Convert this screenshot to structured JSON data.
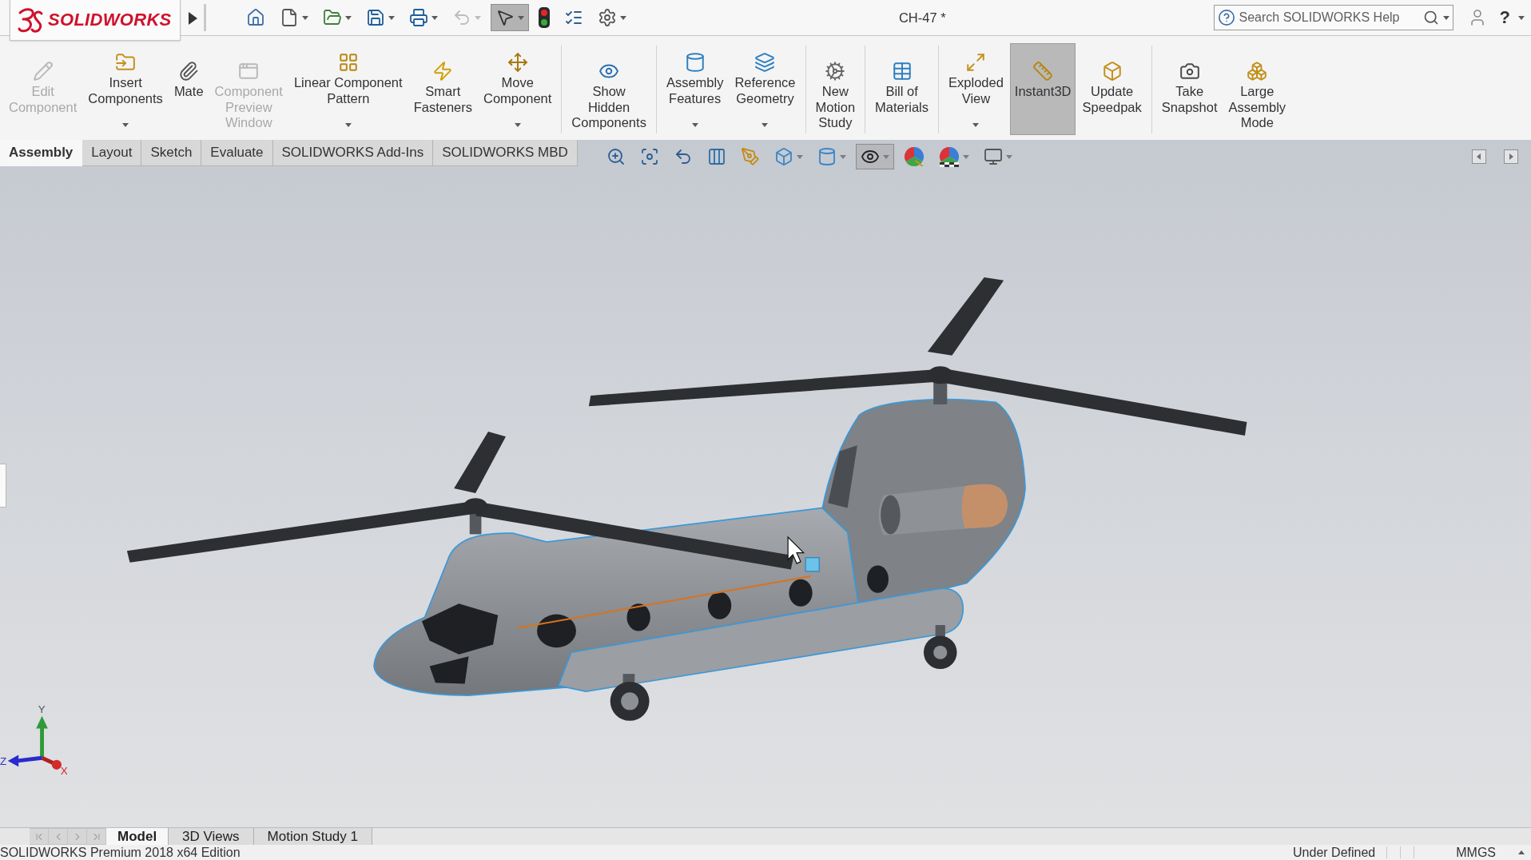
{
  "title_bar": {
    "logo_text": "SOLIDWORKS",
    "quick_access": [
      {
        "menu": false,
        "pressed": false,
        "disabled": false
      },
      {
        "menu": true,
        "pressed": false,
        "disabled": false
      },
      {
        "menu": true,
        "pressed": false,
        "disabled": false
      },
      {
        "menu": true,
        "pressed": false,
        "disabled": false
      },
      {
        "menu": true,
        "pressed": false,
        "disabled": false
      },
      {
        "menu": true,
        "pressed": false,
        "disabled": true
      },
      {
        "menu": true,
        "pressed": true,
        "disabled": false
      },
      {
        "menu": false,
        "pressed": false,
        "disabled": false
      },
      {
        "menu": false,
        "pressed": false,
        "disabled": false
      },
      {
        "menu": true,
        "pressed": false,
        "disabled": false
      }
    ],
    "document_title": "CH-47 *",
    "search": {
      "placeholder": "Search SOLIDWORKS Help"
    },
    "help_label": "?"
  },
  "command_manager": {
    "groups": [
      [
        {
          "lines": [
            "Edit",
            "Component"
          ],
          "disabled": true,
          "menu": false,
          "pressed": false
        },
        {
          "lines": [
            "Insert",
            "Components"
          ],
          "disabled": false,
          "menu": true,
          "pressed": false
        },
        {
          "lines": [
            "Mate"
          ],
          "disabled": false,
          "menu": false,
          "pressed": false
        },
        {
          "lines": [
            "Component",
            "Preview",
            "Window"
          ],
          "disabled": true,
          "menu": false,
          "pressed": false
        },
        {
          "lines": [
            "Linear Component",
            "Pattern"
          ],
          "disabled": false,
          "menu": true,
          "pressed": false
        },
        {
          "lines": [
            "Smart",
            "Fasteners"
          ],
          "disabled": false,
          "menu": false,
          "pressed": false
        },
        {
          "lines": [
            "Move",
            "Component"
          ],
          "disabled": false,
          "menu": true,
          "pressed": false
        }
      ],
      [
        {
          "lines": [
            "Show",
            "Hidden",
            "Components"
          ],
          "disabled": false,
          "menu": false,
          "pressed": false
        }
      ],
      [
        {
          "lines": [
            "Assembly",
            "Features"
          ],
          "disabled": false,
          "menu": true,
          "pressed": false
        },
        {
          "lines": [
            "Reference",
            "Geometry"
          ],
          "disabled": false,
          "menu": true,
          "pressed": false
        }
      ],
      [
        {
          "lines": [
            "New",
            "Motion",
            "Study"
          ],
          "disabled": false,
          "menu": false,
          "pressed": false
        }
      ],
      [
        {
          "lines": [
            "Bill of",
            "Materials"
          ],
          "disabled": false,
          "menu": false,
          "pressed": false
        }
      ],
      [
        {
          "lines": [
            "Exploded",
            "View"
          ],
          "disabled": false,
          "menu": true,
          "pressed": false
        },
        {
          "lines": [
            "Instant3D"
          ],
          "disabled": false,
          "menu": false,
          "pressed": true
        },
        {
          "lines": [
            "Update",
            "Speedpak"
          ],
          "disabled": false,
          "menu": false,
          "pressed": false
        }
      ],
      [
        {
          "lines": [
            "Take",
            "Snapshot"
          ],
          "disabled": false,
          "menu": false,
          "pressed": false
        },
        {
          "lines": [
            "Large",
            "Assembly",
            "Mode"
          ],
          "disabled": false,
          "menu": false,
          "pressed": false
        }
      ]
    ]
  },
  "tabs": [
    {
      "label": "Assembly",
      "selected": true
    },
    {
      "label": "Layout",
      "selected": false
    },
    {
      "label": "Sketch",
      "selected": false
    },
    {
      "label": "Evaluate",
      "selected": false
    },
    {
      "label": "SOLIDWORKS Add-Ins",
      "selected": false
    },
    {
      "label": "SOLIDWORKS MBD",
      "selected": false
    }
  ],
  "view_toolbar": [
    {
      "menu": false,
      "pressed": false
    },
    {
      "menu": false,
      "pressed": false
    },
    {
      "menu": false,
      "pressed": false
    },
    {
      "menu": false,
      "pressed": false
    },
    {
      "menu": false,
      "pressed": false
    },
    {
      "menu": true,
      "pressed": false
    },
    {
      "menu": true,
      "pressed": false
    },
    {
      "menu": true,
      "pressed": true
    },
    {
      "menu": false,
      "pressed": false
    },
    {
      "menu": true,
      "pressed": false
    },
    {
      "menu": true,
      "pressed": false
    }
  ],
  "graphics_area": {
    "axis_labels": [
      "Y",
      "Z",
      "X"
    ]
  },
  "bottom_tabs": {
    "nav": [
      {
        "disabled": true
      },
      {
        "disabled": true
      },
      {
        "disabled": true
      },
      {
        "disabled": true
      }
    ],
    "tabs": [
      {
        "label": "Model",
        "selected": true
      },
      {
        "label": "3D Views",
        "selected": false
      },
      {
        "label": "Motion Study 1",
        "selected": false
      }
    ]
  },
  "status_bar": {
    "edition": "SOLIDWORKS Premium 2018 x64 Edition",
    "state": "Under Defined",
    "units": "MMGS"
  }
}
